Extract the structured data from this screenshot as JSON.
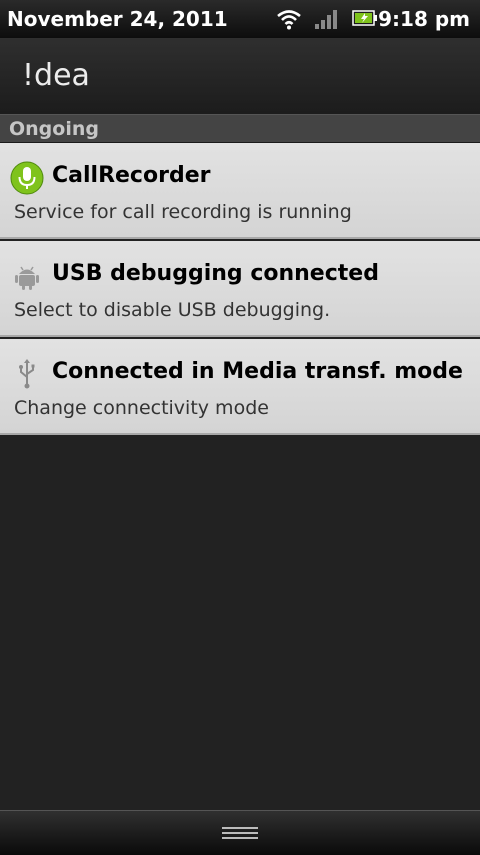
{
  "status_bar": {
    "date": "November 24, 2011",
    "time": "9:18 pm",
    "icons": [
      "wifi-icon",
      "signal-icon",
      "battery-charging-icon"
    ]
  },
  "carrier": "!dea",
  "section": {
    "title": "Ongoing"
  },
  "notifications": [
    {
      "title": "CallRecorder",
      "text": "Service for call recording is running",
      "icon": "microphone-icon"
    },
    {
      "title": "USB debugging connected",
      "text": "Select to disable USB debugging.",
      "icon": "android-icon"
    },
    {
      "title": "Connected in Media transf. mode",
      "text": "Change connectivity mode",
      "icon": "usb-icon"
    }
  ],
  "colors": {
    "accent_green": "#7fc31c",
    "background": "#222222",
    "notification_bg": "#dadada"
  }
}
